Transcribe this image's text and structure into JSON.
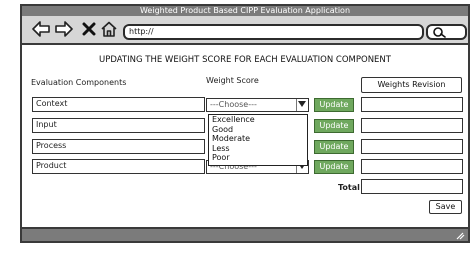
{
  "window": {
    "title": "Weighted Product Based CIPP Evaluation Application"
  },
  "toolbar": {
    "url": "http://",
    "icons": [
      "back-arrow-icon",
      "forward-arrow-icon",
      "close-x-icon",
      "home-icon",
      "search-icon"
    ]
  },
  "page": {
    "heading": "UPDATING THE WEIGHT SCORE FOR EACH EVALUATION COMPONENT",
    "col_components": "Evaluation Components",
    "col_weight": "Weight Score",
    "weights_revision_label": "Weights Revision",
    "rows": [
      {
        "component": "Context",
        "weight": "---Choose---",
        "update_label": "Update",
        "revision_value": ""
      },
      {
        "component": "Input",
        "weight": "",
        "update_label": "Update",
        "revision_value": ""
      },
      {
        "component": "Process",
        "weight": "",
        "update_label": "Update",
        "revision_value": ""
      },
      {
        "component": "Product",
        "weight": "---Choose---",
        "update_label": "Update",
        "revision_value": ""
      }
    ],
    "dropdown_options": [
      "Excellence",
      "Good",
      "Moderate",
      "Less",
      "Poor"
    ],
    "total_label": "Total",
    "total_value": "",
    "save_label": "Save"
  }
}
